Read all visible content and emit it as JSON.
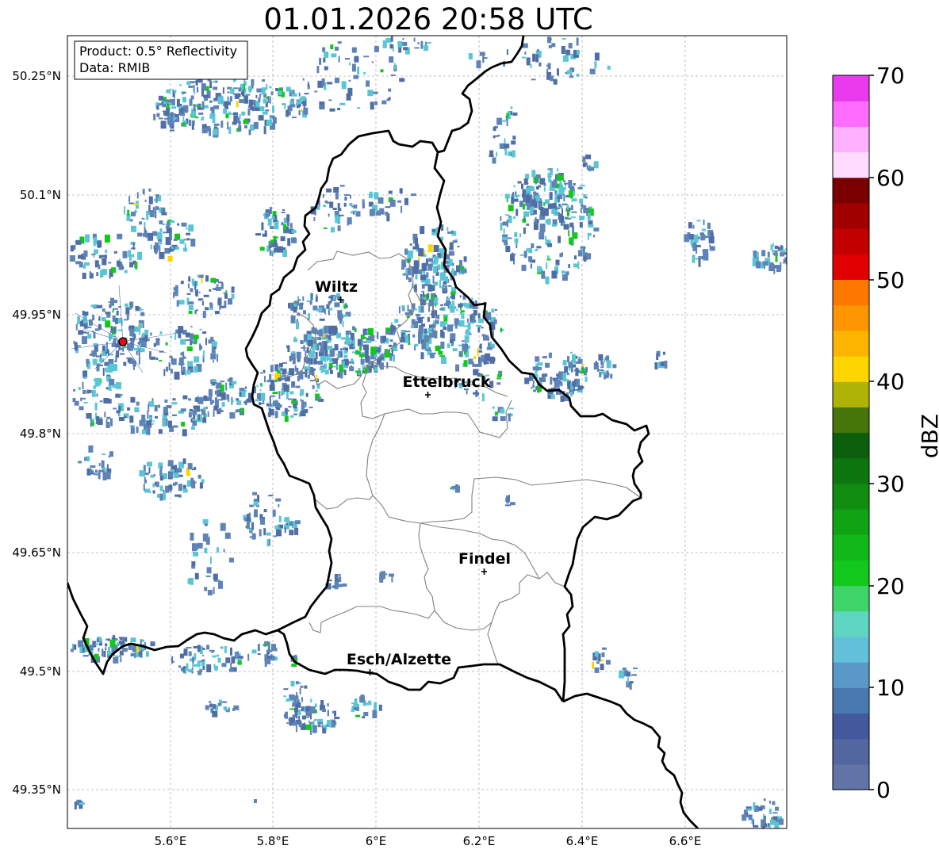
{
  "title": "01.01.2026 20:58 UTC",
  "info": {
    "product": "Product: 0.5° Reflectivity",
    "data": "Data: RMIB"
  },
  "lat_labels": [
    "50.25°N",
    "50.1°N",
    "49.95°N",
    "49.8°N",
    "49.65°N",
    "49.5°N",
    "49.35°N"
  ],
  "lon_labels": [
    "5.6°E",
    "5.8°E",
    "6°E",
    "6.2°E",
    "6.4°E",
    "6.6°E"
  ],
  "cities": [
    {
      "name": "Wiltz"
    },
    {
      "name": "Ettelbruck"
    },
    {
      "name": "Findel"
    },
    {
      "name": "Esch/Alzette"
    }
  ],
  "colorbar": {
    "label": "dBZ",
    "ticks": [
      "0",
      "10",
      "20",
      "30",
      "40",
      "50",
      "60",
      "70"
    ],
    "colors": [
      "#6273a8",
      "#52669f",
      "#425a9d",
      "#4a78b0",
      "#5998c7",
      "#63c0da",
      "#5fd6c2",
      "#3fd46a",
      "#13c81c",
      "#12b81a",
      "#10a313",
      "#108c10",
      "#0e760e",
      "#0b5e0b",
      "#467509",
      "#afb306",
      "#fdd600",
      "#fdb400",
      "#fd9600",
      "#fd7800",
      "#e00000",
      "#c30000",
      "#a00000",
      "#7a0000",
      "#ffdcff",
      "#ffb0ff",
      "#ff6cff",
      "#e93aee"
    ]
  },
  "palette": {
    "light": "#5f83b6",
    "mid": "#4f6ea6",
    "cyan": "#5ac6d4",
    "green": "#13c81c",
    "yellow": "#fdd600",
    "radar_marker": "#e01010"
  }
}
